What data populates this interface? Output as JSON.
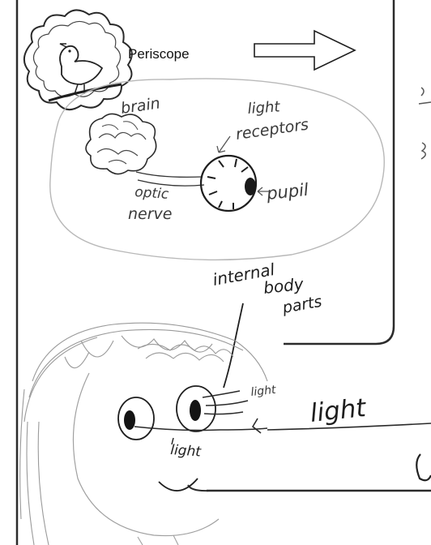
{
  "printed": {
    "periscope_label": "Periscope"
  },
  "handwriting": {
    "brain": "brain",
    "light_receptors_1": "light",
    "light_receptors_2": "receptors",
    "pupil": "pupil",
    "optic_1": "optic",
    "optic_2": "nerve",
    "internal_1": "internal",
    "internal_2": "body",
    "internal_3": "parts",
    "light_small": "light",
    "light_big": "light",
    "light_bottom": "light"
  },
  "colors": {
    "ink": "#1e1e1e",
    "pencil": "#6a6a6a",
    "light_pencil": "#a8a8a8",
    "frame": "#2b2b2b"
  }
}
